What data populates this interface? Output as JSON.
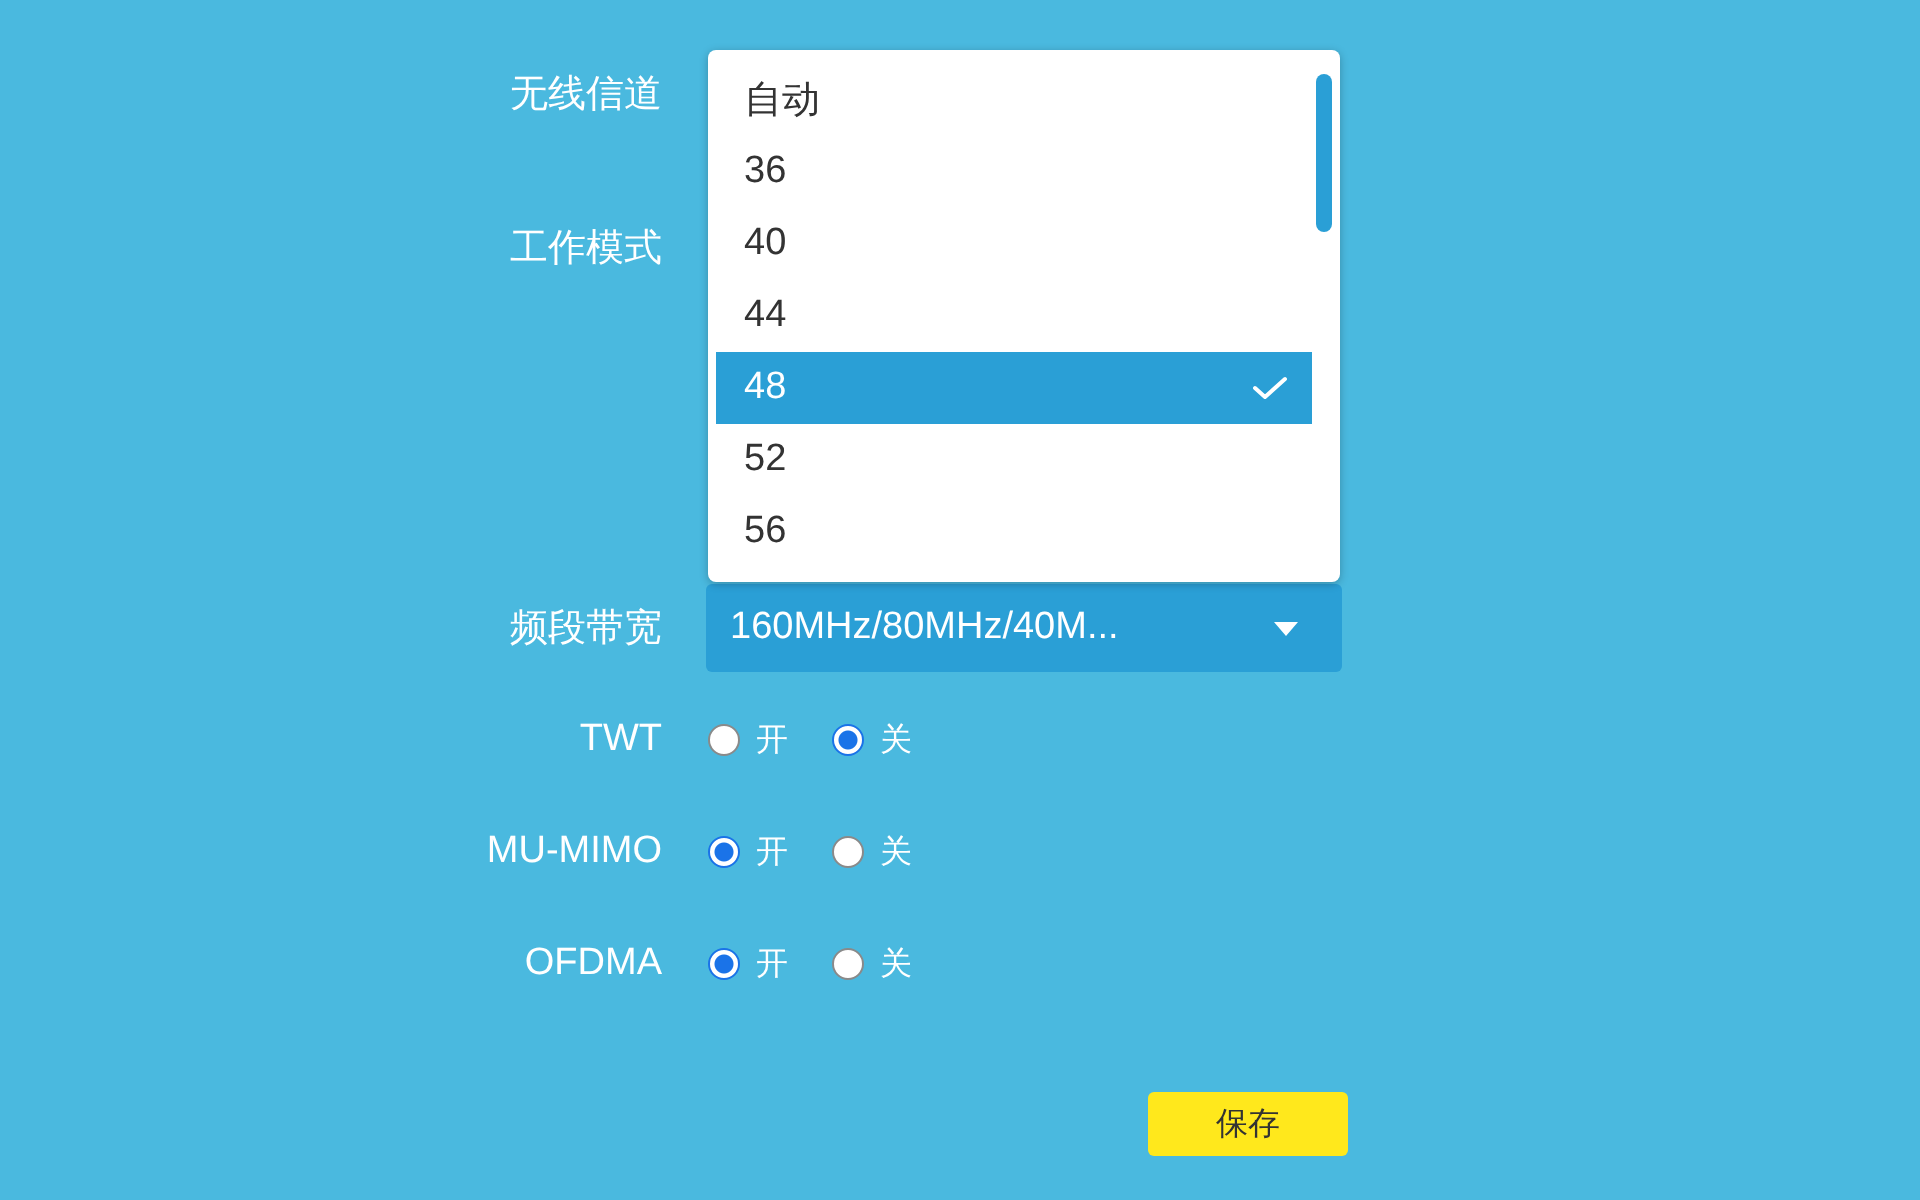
{
  "form": {
    "fields": [
      {
        "kind": "open-select",
        "label": "无线信道",
        "dropdown": {
          "options": [
            {
              "label": "自动",
              "selected": false
            },
            {
              "label": "36",
              "selected": false
            },
            {
              "label": "40",
              "selected": false
            },
            {
              "label": "44",
              "selected": false
            },
            {
              "label": "48",
              "selected": true
            },
            {
              "label": "52",
              "selected": false
            },
            {
              "label": "56",
              "selected": false
            }
          ]
        }
      },
      {
        "kind": "covered",
        "label": "工作模式"
      },
      {
        "kind": "select",
        "label": "频段带宽",
        "value": "160MHz/80MHz/40M..."
      },
      {
        "kind": "radio",
        "label": "TWT",
        "options": [
          {
            "label": "开",
            "selected": false
          },
          {
            "label": "关",
            "selected": true
          }
        ]
      },
      {
        "kind": "radio",
        "label": "MU-MIMO",
        "options": [
          {
            "label": "开",
            "selected": true
          },
          {
            "label": "关",
            "selected": false
          }
        ]
      },
      {
        "kind": "radio",
        "label": "OFDMA",
        "options": [
          {
            "label": "开",
            "selected": true
          },
          {
            "label": "关",
            "selected": false
          }
        ]
      }
    ]
  },
  "save_button": {
    "label": "保存"
  }
}
